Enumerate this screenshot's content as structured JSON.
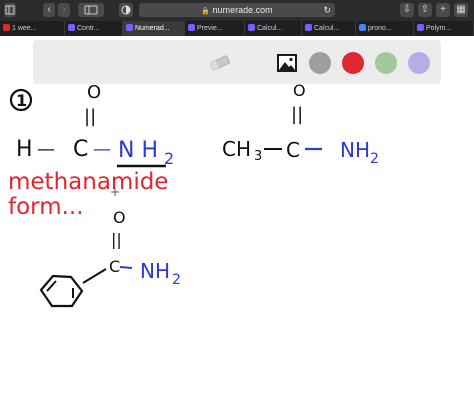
{
  "browser": {
    "url": "numerade.com",
    "tabs": [
      {
        "label": "1 wee...",
        "icon": "gmail-icon",
        "color": "#d93025"
      },
      {
        "label": "Contr...",
        "icon": "numerade-icon",
        "color": "#7b5cff"
      },
      {
        "label": "Numerad...",
        "icon": "numerade-icon",
        "color": "#7b5cff",
        "active": true
      },
      {
        "label": "Previe...",
        "icon": "numerade-icon",
        "color": "#7b5cff"
      },
      {
        "label": "Calcul...",
        "icon": "numerade-icon",
        "color": "#7b5cff"
      },
      {
        "label": "Calcul...",
        "icon": "numerade-icon",
        "color": "#7b5cff"
      },
      {
        "label": "prono...",
        "icon": "google-icon",
        "color": "#4285f4"
      },
      {
        "label": "Polym...",
        "icon": "numerade-icon",
        "color": "#7b5cff"
      }
    ]
  },
  "toolbar": {
    "colors": [
      "#9e9e9e",
      "#e0262f",
      "#9fcb98",
      "#b3aee6"
    ]
  },
  "whiteboard": {
    "question_number": "1",
    "formamide": {
      "h": "H",
      "dash1": "—",
      "c": "C",
      "dash2": "—",
      "nh": "N H",
      "sub": "2",
      "o": "O",
      "bond": "||"
    },
    "name_line1": "methanamide",
    "name_line2": "form...",
    "acetamide": {
      "ch": "CH",
      "sub3": "3",
      "c": "C",
      "nh": "NH",
      "sub2": "2",
      "o": "O",
      "bond": "||"
    },
    "benzamide": {
      "c": "C",
      "nh": "NH",
      "sub2": "2",
      "o": "O",
      "bond": "||"
    },
    "cursor": "+",
    "ink_black": "#111111",
    "ink_blue": "#2a3bd6",
    "ink_red": "#e0262f"
  }
}
